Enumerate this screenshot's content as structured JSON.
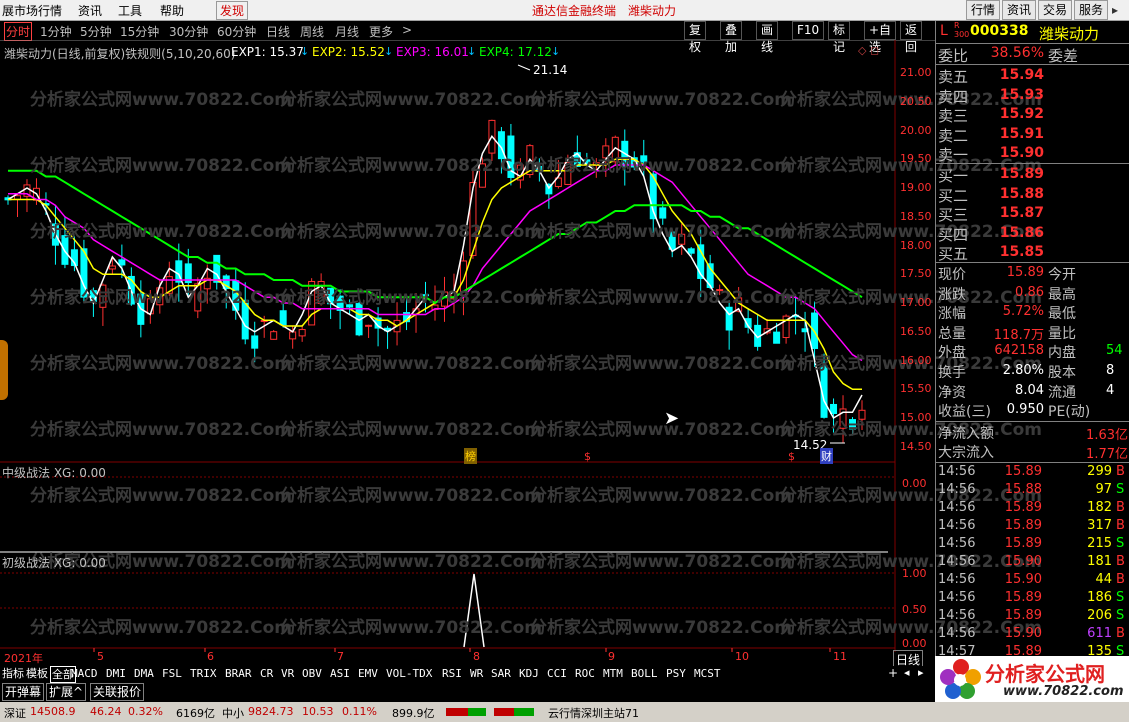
{
  "menubar": {
    "items": [
      "展市场行情",
      "资讯",
      "工具",
      "帮助"
    ],
    "discover": "发现",
    "center_title": "通达信金融终端",
    "center_stock": "潍柴动力",
    "right_buttons": [
      "行情",
      "资讯",
      "交易",
      "服务"
    ]
  },
  "periods": [
    "分时",
    "1分钟",
    "5分钟",
    "15分钟",
    "30分钟",
    "60分钟",
    "日线",
    "周线",
    "月线",
    "更多",
    ">"
  ],
  "toolbar": [
    "复权",
    "叠加",
    "画线",
    "F10",
    "标记",
    "+自选",
    "返回"
  ],
  "chart": {
    "title_prefix": "潍柴动力(日线,前复权)铁规则(5,10,20,60)",
    "exp1": "EXP1: 15.37",
    "exp2": "EXP2: 15.52",
    "exp3": "EXP3: 16.01",
    "exp4": "EXP4: 17.12",
    "high_label": "21.14",
    "low_label": "14.52",
    "y_labels": [
      "21.00",
      "20.50",
      "20.00",
      "19.50",
      "19.00",
      "18.50",
      "18.00",
      "17.50",
      "17.00",
      "16.50",
      "16.00",
      "15.50",
      "15.00",
      "14.50"
    ],
    "markers": [
      "榜",
      "$",
      "$",
      "财"
    ],
    "panel2_title": "中级战法  XG: 0.00",
    "panel2_y": "0.00",
    "panel3_title": "初级战法  XG: 0.00",
    "panel3_y": [
      "1.00",
      "0.50",
      "0.00"
    ],
    "months": [
      "2021年",
      "5",
      "6",
      "7",
      "8",
      "9",
      "10",
      "11"
    ],
    "period_label": "日线",
    "watermark": "分析家公式网www.70822.Com"
  },
  "chart_data": {
    "type": "candlestick",
    "title": "潍柴动力(日线,前复权)铁规则(5,10,20,60)",
    "ylim": [
      14.3,
      21.3
    ],
    "series": [
      {
        "name": "EXP1",
        "color": "#ffffff",
        "last": 15.37
      },
      {
        "name": "EXP2",
        "color": "#ffff00",
        "last": 15.52
      },
      {
        "name": "EXP3",
        "color": "#ff00ff",
        "last": 16.01
      },
      {
        "name": "EXP4",
        "color": "#00ff00",
        "last": 17.12
      }
    ],
    "ma1": [
      18.8,
      18.9,
      19.0,
      18.9,
      18.6,
      18.2,
      17.9,
      17.7,
      17.3,
      17.0,
      17.4,
      17.8,
      17.6,
      17.2,
      16.9,
      16.8,
      17.3,
      17.6,
      17.5,
      17.1,
      17.3,
      17.6,
      17.5,
      17.2,
      16.9,
      16.6,
      16.5,
      16.6,
      16.7,
      16.6,
      16.5,
      16.8,
      17.2,
      17.3,
      17.0,
      16.9,
      16.8,
      16.7,
      16.8,
      16.6,
      16.5,
      16.6,
      16.7,
      16.9,
      17.1,
      17.0,
      17.1,
      17.2,
      18.0,
      19.0,
      19.6,
      19.9,
      19.7,
      19.3,
      19.2,
      19.5,
      19.3,
      19.0,
      19.2,
      19.5,
      19.6,
      19.4,
      19.3,
      19.5,
      19.7,
      19.6,
      19.5,
      19.2,
      18.6,
      18.2,
      17.9,
      18.0,
      17.8,
      17.5,
      17.3,
      17.0,
      16.8,
      16.9,
      16.6,
      16.4,
      16.5,
      16.6,
      16.7,
      16.8,
      16.7,
      16.0,
      15.3,
      15.0,
      15.1,
      15.1,
      15.4
    ],
    "ma2": [
      18.8,
      18.8,
      18.8,
      18.8,
      18.7,
      18.5,
      18.3,
      18.1,
      17.9,
      17.6,
      17.5,
      17.5,
      17.5,
      17.4,
      17.2,
      17.1,
      17.1,
      17.2,
      17.3,
      17.3,
      17.3,
      17.4,
      17.4,
      17.3,
      17.2,
      17.0,
      16.8,
      16.7,
      16.7,
      16.6,
      16.6,
      16.6,
      16.8,
      16.9,
      16.9,
      16.9,
      16.9,
      16.8,
      16.8,
      16.7,
      16.7,
      16.6,
      16.7,
      16.8,
      16.9,
      17.0,
      17.1,
      17.1,
      17.4,
      17.9,
      18.4,
      18.8,
      19.0,
      19.1,
      19.2,
      19.3,
      19.3,
      19.3,
      19.3,
      19.3,
      19.4,
      19.4,
      19.4,
      19.4,
      19.5,
      19.5,
      19.5,
      19.4,
      19.2,
      18.9,
      18.6,
      18.4,
      18.2,
      17.9,
      17.6,
      17.4,
      17.2,
      17.0,
      16.9,
      16.8,
      16.7,
      16.7,
      16.7,
      16.7,
      16.7,
      16.5,
      16.2,
      15.8,
      15.6,
      15.5,
      15.5
    ],
    "ma3": [
      18.9,
      18.9,
      18.9,
      18.8,
      18.8,
      18.7,
      18.5,
      18.4,
      18.3,
      18.1,
      18.0,
      17.9,
      17.8,
      17.7,
      17.6,
      17.5,
      17.4,
      17.4,
      17.4,
      17.4,
      17.4,
      17.4,
      17.4,
      17.4,
      17.4,
      17.3,
      17.2,
      17.1,
      17.1,
      17.0,
      17.0,
      16.9,
      16.9,
      16.9,
      16.9,
      16.9,
      16.9,
      16.9,
      16.9,
      16.8,
      16.8,
      16.8,
      16.8,
      16.8,
      16.8,
      16.9,
      16.9,
      17.0,
      17.1,
      17.3,
      17.6,
      17.8,
      18.0,
      18.2,
      18.4,
      18.6,
      18.7,
      18.8,
      18.9,
      19.0,
      19.1,
      19.2,
      19.3,
      19.3,
      19.4,
      19.4,
      19.4,
      19.4,
      19.3,
      19.2,
      19.1,
      18.9,
      18.7,
      18.5,
      18.3,
      18.1,
      17.9,
      17.7,
      17.5,
      17.4,
      17.3,
      17.2,
      17.1,
      17.1,
      17.0,
      16.9,
      16.7,
      16.5,
      16.3,
      16.1,
      16.0
    ],
    "ma4": [
      19.3,
      19.3,
      19.3,
      19.3,
      19.2,
      19.2,
      19.1,
      19.0,
      18.9,
      18.8,
      18.7,
      18.6,
      18.5,
      18.4,
      18.3,
      18.2,
      18.1,
      18.0,
      17.9,
      17.8,
      17.8,
      17.7,
      17.7,
      17.6,
      17.6,
      17.5,
      17.5,
      17.5,
      17.4,
      17.4,
      17.4,
      17.3,
      17.3,
      17.3,
      17.3,
      17.2,
      17.2,
      17.2,
      17.2,
      17.1,
      17.1,
      17.1,
      17.1,
      17.1,
      17.1,
      17.0,
      17.1,
      17.1,
      17.2,
      17.3,
      17.4,
      17.5,
      17.6,
      17.7,
      17.8,
      17.9,
      18.0,
      18.1,
      18.2,
      18.2,
      18.3,
      18.4,
      18.4,
      18.5,
      18.6,
      18.6,
      18.7,
      18.7,
      18.7,
      18.7,
      18.7,
      18.7,
      18.6,
      18.6,
      18.5,
      18.5,
      18.4,
      18.3,
      18.3,
      18.2,
      18.1,
      18.0,
      17.9,
      17.8,
      17.7,
      17.6,
      17.5,
      17.4,
      17.3,
      17.2,
      17.1
    ]
  },
  "right": {
    "code_label": "L",
    "code": "000338",
    "name": "潍柴动力",
    "webi_label": "委比",
    "webi_val": "38.56%",
    "weicha_label": "委差",
    "sells": [
      {
        "label": "卖五",
        "price": "15.94"
      },
      {
        "label": "卖四",
        "price": "15.93"
      },
      {
        "label": "卖三",
        "price": "15.92"
      },
      {
        "label": "卖二",
        "price": "15.91"
      },
      {
        "label": "卖一",
        "price": "15.90"
      }
    ],
    "buys": [
      {
        "label": "买一",
        "price": "15.89"
      },
      {
        "label": "买二",
        "price": "15.88"
      },
      {
        "label": "买三",
        "price": "15.87"
      },
      {
        "label": "买四",
        "price": "15.86"
      },
      {
        "label": "买五",
        "price": "15.85"
      }
    ],
    "stats": [
      {
        "l1": "现价",
        "v1": "15.89",
        "l2": "今开",
        "v2": ""
      },
      {
        "l1": "涨跌",
        "v1": "0.86",
        "l2": "最高",
        "v2": ""
      },
      {
        "l1": "涨幅",
        "v1": "5.72%",
        "l2": "最低",
        "v2": ""
      },
      {
        "l1": "总量",
        "v1": "118.7万",
        "l2": "量比",
        "v2": ""
      },
      {
        "l1": "外盘",
        "v1": "642158",
        "l2": "内盘",
        "v2": "54"
      },
      {
        "l1": "换手",
        "v1": "2.80%",
        "l2": "股本",
        "v2": "8"
      },
      {
        "l1": "净资",
        "v1": "8.04",
        "l2": "流通",
        "v2": "4"
      },
      {
        "l1": "收益(三)",
        "v1": "0.950",
        "l2": "PE(动)",
        "v2": ""
      }
    ],
    "flows": [
      {
        "label": "净流入额",
        "val": "1.63亿"
      },
      {
        "label": "大宗流入",
        "val": "1.77亿"
      }
    ],
    "ticks": [
      {
        "t": "14:56",
        "p": "15.89",
        "v": "299",
        "d": "B"
      },
      {
        "t": "14:56",
        "p": "15.88",
        "v": "97",
        "d": "S"
      },
      {
        "t": "14:56",
        "p": "15.89",
        "v": "182",
        "d": "B"
      },
      {
        "t": "14:56",
        "p": "15.89",
        "v": "317",
        "d": "B"
      },
      {
        "t": "14:56",
        "p": "15.89",
        "v": "215",
        "d": "S"
      },
      {
        "t": "14:56",
        "p": "15.90",
        "v": "181",
        "d": "B"
      },
      {
        "t": "14:56",
        "p": "15.90",
        "v": "44",
        "d": "B"
      },
      {
        "t": "14:56",
        "p": "15.89",
        "v": "186",
        "d": "S"
      },
      {
        "t": "14:56",
        "p": "15.89",
        "v": "206",
        "d": "S"
      },
      {
        "t": "14:56",
        "p": "15.90",
        "v": "611",
        "d": "B"
      },
      {
        "t": "14:57",
        "p": "15.89",
        "v": "135",
        "d": "S"
      }
    ]
  },
  "indicators": [
    "指标",
    "模板",
    "全部",
    "MACD",
    "DMI",
    "DMA",
    "FSL",
    "TRIX",
    "BRAR",
    "CR",
    "VR",
    "OBV",
    "ASI",
    "EMV",
    "VOL-TDX",
    "RSI",
    "WR",
    "SAR",
    "KDJ",
    "CCI",
    "ROC",
    "MTM",
    "BOLL",
    "PSY",
    "MCST"
  ],
  "bottom_tabs": [
    "开弹幕",
    "扩展^",
    "关联报价"
  ],
  "status": {
    "sh_label": "深证",
    "sh_val": "14508.9",
    "sh_chg": "46.24",
    "sh_pct": "0.32%",
    "sh_amt": "6169亿",
    "mid_label": "中小",
    "mid_val": "9824.73",
    "mid_chg": "10.53",
    "mid_pct": "0.11%",
    "mid_amt": "899.9亿",
    "right_text": "云行情深圳主站71"
  },
  "logo": {
    "name": "分析家公式网",
    "url": "www.70822.com"
  }
}
